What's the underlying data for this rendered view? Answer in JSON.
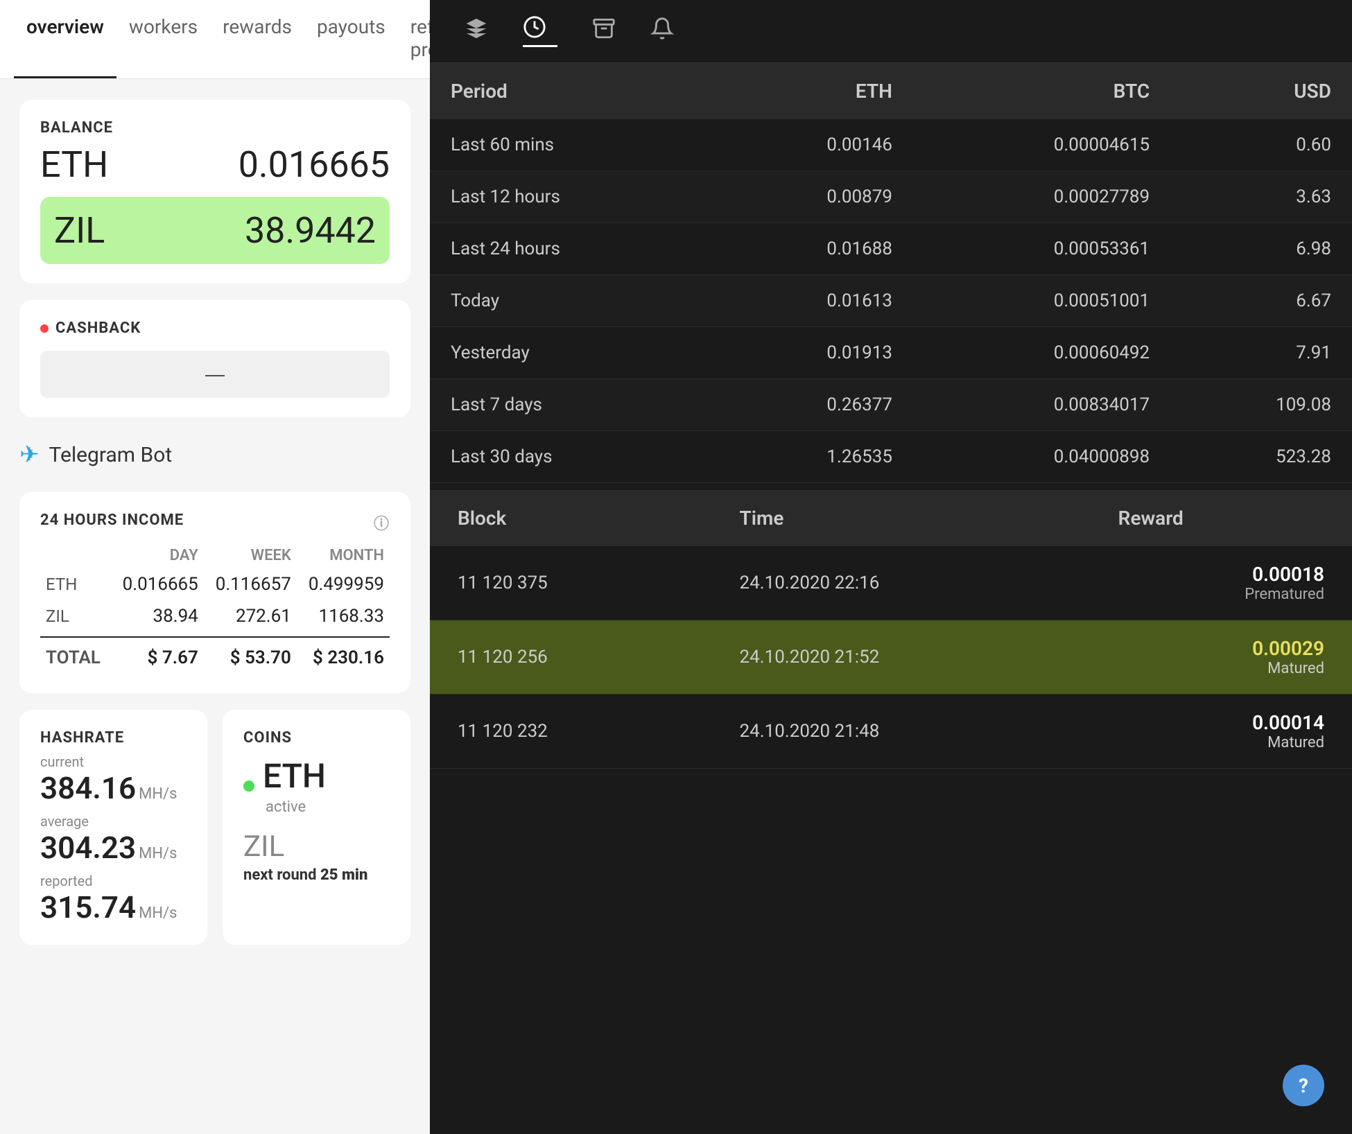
{
  "nav": {
    "tabs": [
      {
        "id": "overview",
        "label": "overview",
        "active": true
      },
      {
        "id": "workers",
        "label": "workers",
        "active": false
      },
      {
        "id": "rewards",
        "label": "rewards",
        "active": false
      },
      {
        "id": "payouts",
        "label": "payouts",
        "active": false
      },
      {
        "id": "referral",
        "label": "referral program",
        "active": false
      }
    ]
  },
  "balance": {
    "title": "BALANCE",
    "eth_label": "ETH",
    "eth_value": "0.016665",
    "zil_label": "ZIL",
    "zil_value": "38.9442"
  },
  "cashback": {
    "title": "CASHBACK",
    "placeholder": "—"
  },
  "telegram": {
    "label": "Telegram Bot"
  },
  "income": {
    "title": "24 HOURS INCOME",
    "col_day": "DAY",
    "col_week": "WEEK",
    "col_month": "MONTH",
    "rows": [
      {
        "label": "ETH",
        "day": "0.016665",
        "week": "0.116657",
        "month": "0.499959"
      },
      {
        "label": "ZIL",
        "day": "38.94",
        "week": "272.61",
        "month": "1168.33"
      },
      {
        "label": "TOTAL",
        "day": "$ 7.67",
        "week": "$ 53.70",
        "month": "$ 230.16"
      }
    ]
  },
  "hashrate": {
    "title": "HASHRATE",
    "current_label": "current",
    "current_value": "384.16",
    "current_unit": "MH/s",
    "average_label": "average",
    "average_value": "304.23",
    "average_unit": "MH/s",
    "reported_label": "reported",
    "reported_value": "315.74",
    "reported_unit": "MH/s"
  },
  "coins": {
    "title": "COINS",
    "eth_name": "ETH",
    "eth_status": "active",
    "zil_name": "ZIL",
    "zil_round_prefix": "next round",
    "zil_round_value": "25 min"
  },
  "right_header": {
    "icons": [
      "layers",
      "timer",
      "archive",
      "bell"
    ]
  },
  "earnings_table": {
    "headers": [
      "Period",
      "ETH",
      "BTC",
      "USD"
    ],
    "rows": [
      {
        "period": "Last 60 mins",
        "eth": "0.00146",
        "btc": "0.00004615",
        "usd": "0.60"
      },
      {
        "period": "Last 12 hours",
        "eth": "0.00879",
        "btc": "0.00027789",
        "usd": "3.63"
      },
      {
        "period": "Last 24 hours",
        "eth": "0.01688",
        "btc": "0.00053361",
        "usd": "6.98"
      },
      {
        "period": "Today",
        "eth": "0.01613",
        "btc": "0.00051001",
        "usd": "6.67"
      },
      {
        "period": "Yesterday",
        "eth": "0.01913",
        "btc": "0.00060492",
        "usd": "7.91"
      },
      {
        "period": "Last 7 days",
        "eth": "0.26377",
        "btc": "0.00834017",
        "usd": "109.08"
      },
      {
        "period": "Last 30 days",
        "eth": "1.26535",
        "btc": "0.04000898",
        "usd": "523.28"
      }
    ]
  },
  "blocks_table": {
    "headers": [
      "Block",
      "Time",
      "Reward"
    ],
    "rows": [
      {
        "block": "11 120 375",
        "time": "24.10.2020 22:16",
        "reward": "0.00018",
        "status": "Prematured",
        "highlighted": false
      },
      {
        "block": "11 120 256",
        "time": "24.10.2020 21:52",
        "reward": "0.00029",
        "status": "Matured",
        "highlighted": true
      },
      {
        "block": "11 120 232",
        "time": "24.10.2020 21:48",
        "reward": "0.00014",
        "status": "Matured",
        "highlighted": false
      }
    ]
  }
}
